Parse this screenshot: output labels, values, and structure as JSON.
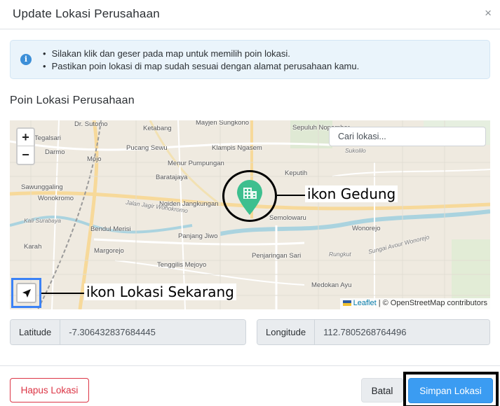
{
  "modal": {
    "title": "Update Lokasi Perusahaan",
    "close_glyph": "×"
  },
  "alert": {
    "icon": "info-icon",
    "lines": [
      "Silakan klik dan geser pada map untuk memilih poin lokasi.",
      "Pastikan poin lokasi di map sudah sesuai dengan alamat perusahaan kamu."
    ]
  },
  "section_title": "Poin Lokasi Perusahaan",
  "map": {
    "zoom_in": "+",
    "zoom_out": "−",
    "search_placeholder": "Cari lokasi...",
    "marker_icon": "building-icon",
    "marker_color": "#3dbf8f",
    "locate_icon": "navigation-arrow-icon",
    "attribution_leaflet": "Leaflet",
    "attribution_rest": "| © OpenStreetMap contributors",
    "labels": {
      "dr_sutomo": "Dr. Sutomo",
      "ketabang": "Ketabang",
      "mayjen": "Mayjen Sungkono",
      "tegalsari": "Tegalsari",
      "pucang": "Pucang Sewu",
      "klampis": "Klampis Ngasem",
      "keputih": "Keputih",
      "darmo": "Darmo",
      "mojo": "Mojo",
      "menur": "Menur Pumpungan",
      "sukolilo": "Sukolilo",
      "sepuluh": "Sepuluh Nopember",
      "baratajaya": "Baratajaya",
      "sawunggaling": "Sawunggaling",
      "wonokromo": "Wonokromo",
      "ngiden": "Ngiden Jangkungan",
      "jagir": "Jalan Jagir Wonokromo",
      "semolo": "Semolowaru",
      "bendul": "Bendul Merisi",
      "panjang": "Panjang Jiwo",
      "wonorejo": "Wonorejo",
      "kali": "Kali Surabaya",
      "kutisari": "Karah",
      "margorejo": "Margorejo",
      "penjaringan": "Penjaringan Sari",
      "rungkut": "Rungkut",
      "tenggilis": "Tenggilis Mejoyo",
      "medokan": "Medokan Ayu",
      "sungai": "Sungai Avour Wonorejo"
    }
  },
  "annotations": {
    "gedung": "ikon Gedung",
    "lokasi": "ikon Lokasi Sekarang"
  },
  "coords": {
    "lat_label": "Latitude",
    "lat_value": "-7.306432837684445",
    "lng_label": "Longitude",
    "lng_value": "112.7805268764496"
  },
  "footer": {
    "hapus": "Hapus Lokasi",
    "batal": "Batal",
    "simpan": "Simpan Lokasi"
  }
}
